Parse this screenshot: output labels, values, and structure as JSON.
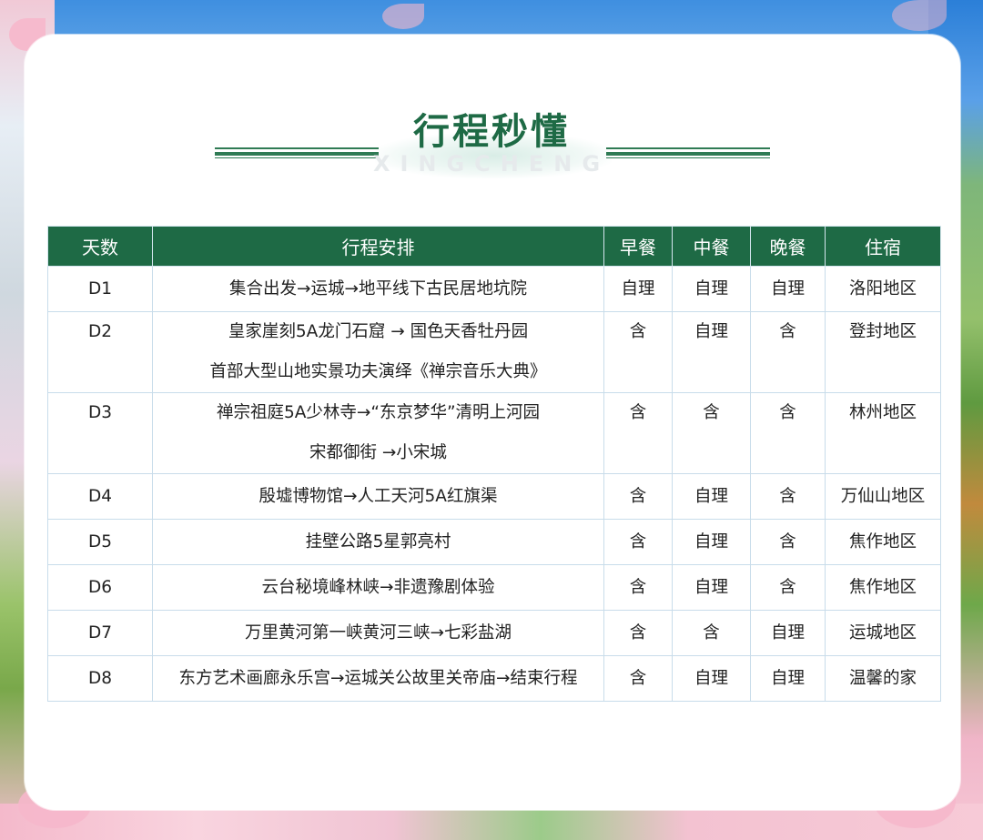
{
  "title": "行程秒懂",
  "subtitle": "XINGCHENG",
  "columns": [
    "天数",
    "行程安排",
    "早餐",
    "中餐",
    "晚餐",
    "住宿"
  ],
  "rows": [
    {
      "day": "D1",
      "plan": [
        "集合出发→运城→地平线下古民居地坑院"
      ],
      "breakfast": "自理",
      "lunch": "自理",
      "dinner": "自理",
      "stay": "洛阳地区"
    },
    {
      "day": "D2",
      "plan": [
        "皇家崖刻5A龙门石窟 → 国色天香牡丹园",
        "首部大型山地实景功夫演绎《禅宗音乐大典》"
      ],
      "breakfast": "含",
      "lunch": "自理",
      "dinner": "含",
      "stay": "登封地区"
    },
    {
      "day": "D3",
      "plan": [
        "禅宗祖庭5A少林寺→“东京梦华”清明上河园",
        "宋都御街 →小宋城"
      ],
      "breakfast": "含",
      "lunch": "含",
      "dinner": "含",
      "stay": "林州地区"
    },
    {
      "day": "D4",
      "plan": [
        "殷墟博物馆→人工天河5A红旗渠"
      ],
      "breakfast": "含",
      "lunch": "自理",
      "dinner": "含",
      "stay": "万仙山地区"
    },
    {
      "day": "D5",
      "plan": [
        "挂壁公路5星郭亮村"
      ],
      "breakfast": "含",
      "lunch": "自理",
      "dinner": "含",
      "stay": "焦作地区"
    },
    {
      "day": "D6",
      "plan": [
        "云台秘境峰林峡→非遗豫剧体验"
      ],
      "breakfast": "含",
      "lunch": "自理",
      "dinner": "含",
      "stay": "焦作地区"
    },
    {
      "day": "D7",
      "plan": [
        "万里黄河第一峡黄河三峡→七彩盐湖"
      ],
      "breakfast": "含",
      "lunch": "含",
      "dinner": "自理",
      "stay": "运城地区"
    },
    {
      "day": "D8",
      "plan": [
        "东方艺术画廊永乐宫→运城关公故里关帝庙→结束行程"
      ],
      "breakfast": "含",
      "lunch": "自理",
      "dinner": "自理",
      "stay": "温馨的家"
    }
  ],
  "colors": {
    "header_green": "#1e6a45",
    "title_green": "#1e6a45",
    "grid": "#c8dcea"
  }
}
